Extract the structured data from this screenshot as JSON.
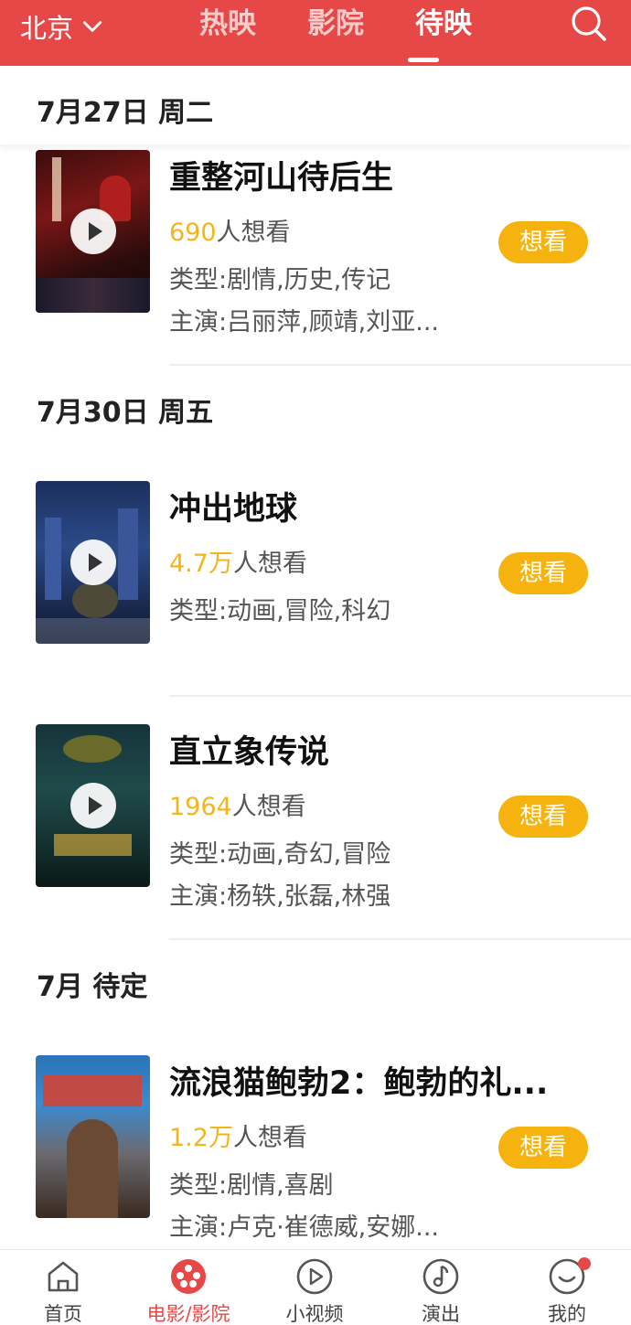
{
  "header": {
    "city": "北京",
    "tabs": [
      {
        "label": "热映"
      },
      {
        "label": "影院"
      },
      {
        "label": "待映"
      }
    ],
    "active_tab": "待映",
    "accent_color": "#e54847"
  },
  "sections": [
    {
      "date": "7月27日 周二",
      "movies": [
        {
          "title": "重整河山待后生",
          "want_count": "690",
          "want_suffix": "人想看",
          "genre": "类型:剧情,历史,传记",
          "cast": "主演:吕丽萍,顾靖,刘亚...",
          "button": "想看"
        }
      ]
    },
    {
      "date": "7月30日 周五",
      "movies": [
        {
          "title": "冲出地球",
          "want_count": "4.7万",
          "want_suffix": "人想看",
          "genre": "类型:动画,冒险,科幻",
          "button": "想看"
        },
        {
          "title": "直立象传说",
          "want_count": "1964",
          "want_suffix": "人想看",
          "genre": "类型:动画,奇幻,冒险",
          "cast": "主演:杨轶,张磊,林强",
          "button": "想看"
        }
      ]
    },
    {
      "date": "7月 待定",
      "movies": [
        {
          "title": "流浪猫鲍勃2：鲍勃的礼...",
          "want_count": "1.2万",
          "want_suffix": "人想看",
          "genre": "类型:剧情,喜剧",
          "cast": "主演:卢克·崔德威,安娜...",
          "button": "想看"
        }
      ]
    }
  ],
  "bottom_nav": [
    {
      "label": "首页",
      "icon": "home-icon"
    },
    {
      "label": "电影/影院",
      "icon": "film-reel-icon",
      "active": true
    },
    {
      "label": "小视频",
      "icon": "play-circle-icon"
    },
    {
      "label": "演出",
      "icon": "music-note-icon"
    },
    {
      "label": "我的",
      "icon": "profile-icon",
      "badge": true
    }
  ],
  "colors": {
    "want_button": "#f6b20e",
    "want_count": "#f3b51b"
  }
}
